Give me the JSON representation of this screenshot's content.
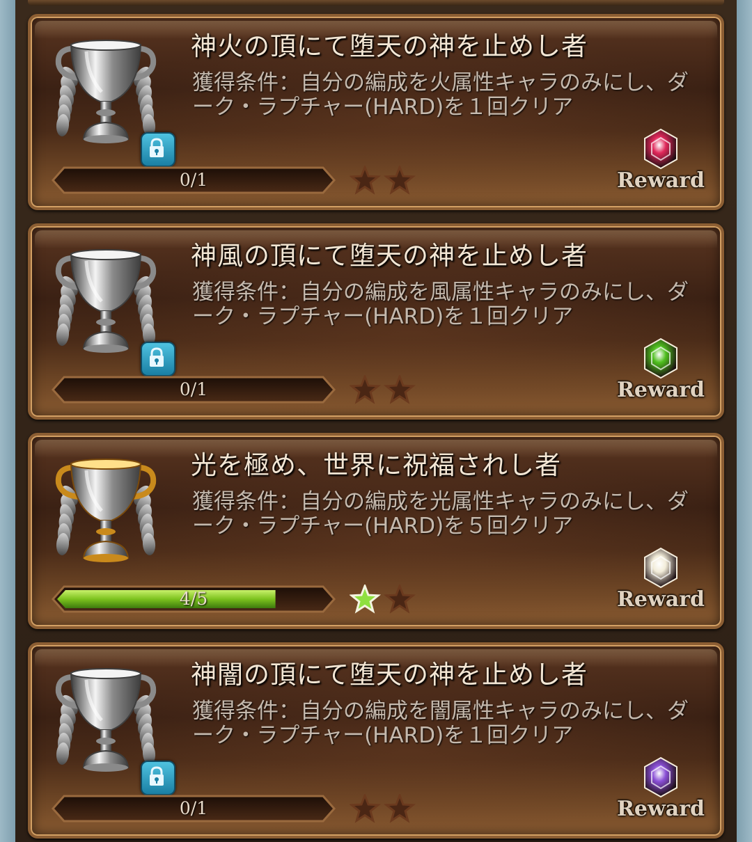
{
  "achievements": [
    {
      "title": "神火の頂にて堕天の神を止めし者",
      "condition": "獲得条件：自分の編成を火属性キャラのみにし、ダーク・ラプチャー(HARD)を１回クリア",
      "progress_text": "0/1",
      "progress": 0,
      "trophy": "silver-trophy-icon",
      "locked": true,
      "stars_earned": 0,
      "stars_total": 2,
      "reward_label": "Reward",
      "gem_color": "#e0285a"
    },
    {
      "title": "神風の頂にて堕天の神を止めし者",
      "condition": "獲得条件：自分の編成を風属性キャラのみにし、ダーク・ラプチャー(HARD)を１回クリア",
      "progress_text": "0/1",
      "progress": 0,
      "trophy": "silver-trophy-icon",
      "locked": true,
      "stars_earned": 0,
      "stars_total": 2,
      "reward_label": "Reward",
      "gem_color": "#4fbf1f"
    },
    {
      "title": "光を極め、世界に祝福されし者",
      "condition": "獲得条件：自分の編成を光属性キャラのみにし、ダーク・ラプチャー(HARD)を５回クリア",
      "progress_text": "4/5",
      "progress": 0.8,
      "trophy": "gold-trophy-icon",
      "locked": false,
      "stars_earned": 1,
      "stars_total": 2,
      "reward_label": "Reward",
      "gem_color": "#f2ecd9"
    },
    {
      "title": "神闇の頂にて堕天の神を止めし者",
      "condition": "獲得条件：自分の編成を闇属性キャラのみにし、ダーク・ラプチャー(HARD)を１回クリア",
      "progress_text": "0/1",
      "progress": 0,
      "trophy": "silver-trophy-icon",
      "locked": true,
      "stars_earned": 0,
      "stars_total": 2,
      "reward_label": "Reward",
      "gem_color": "#8a4fd6"
    }
  ]
}
